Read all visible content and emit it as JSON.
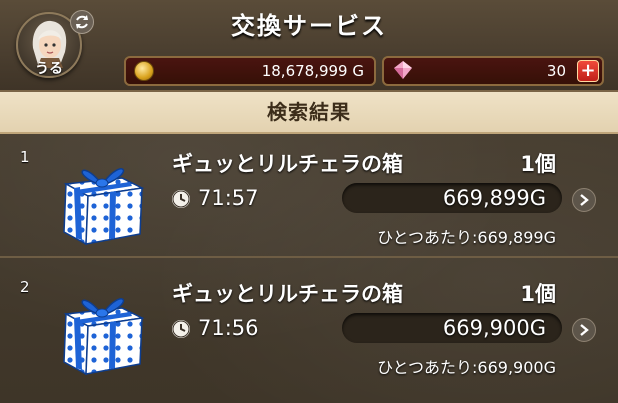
{
  "header": {
    "title": "交換サービス",
    "player_name": "うる",
    "gold_value": "18,678,999 G",
    "gem_value": "30",
    "plus_symbol": "+"
  },
  "section": {
    "label": "検索結果"
  },
  "results": [
    {
      "index": "1",
      "name": "ギュッとリルチェラの箱",
      "quantity": "1個",
      "time_left": "71:57",
      "price": "669,899G",
      "unit_price": "ひとつあたり:669,899G"
    },
    {
      "index": "2",
      "name": "ギュッとリルチェラの箱",
      "quantity": "1個",
      "time_left": "71:56",
      "price": "669,900G",
      "unit_price": "ひとつあたり:669,900G"
    }
  ],
  "icons": {
    "avatar": "avatar-icon",
    "sync": "sync-icon",
    "gold": "gold-coin-icon",
    "gem": "gem-icon",
    "gift": "gift-box-icon",
    "clock": "clock-icon",
    "arrow": "chevron-right-icon"
  },
  "colors": {
    "header_bg": "#4a3e2f",
    "currency_bar_bg": "#4a1410",
    "currency_bar_border": "#8c6a3e",
    "section_label_bg": "#efe2c6",
    "plus_button": "#e0362a",
    "gift_blue": "#1e63d6",
    "price_pill_bg": "#2b241b"
  }
}
